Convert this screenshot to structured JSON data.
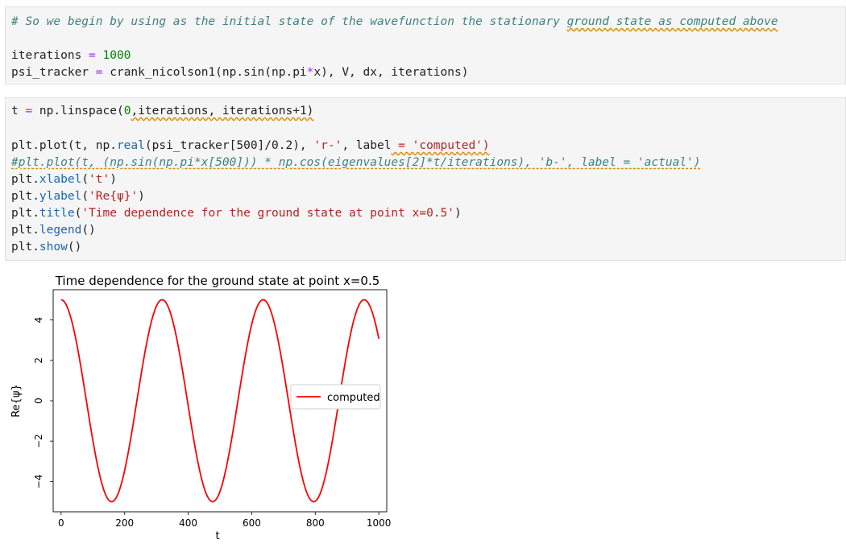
{
  "cell1": {
    "comment": "# So we begin by using as the initial state of the wavefunction the stationary ",
    "comment_flagged": "ground state as computed above",
    "line2_var": "iterations ",
    "line2_op": "=",
    "line2_num": " 1000",
    "line3_a": "psi_tracker ",
    "line3_op": "=",
    "line3_b": " crank_nicolson1(np.sin(np.pi",
    "line3_op2": "*",
    "line3_c": "x), V, dx, iterations)"
  },
  "cell2": {
    "l1_a": "t ",
    "l1_op": "=",
    "l1_b": " np.linspace(",
    "l1_num": "0",
    "l1_flag": ",iterations, iterations+1)",
    "l2_a": "plt.plot(t, np.",
    "l2_fn": "real",
    "l2_b": "(psi_tracker[500]/0.2), ",
    "l2_str": "'r-'",
    "l2_c": ", label",
    "l2_flag": " = 'computed')",
    "l3_comment": "#plt.plot(t, (np.sin(np.pi*x[500])) * np.cos(eigenvalues[2]*t/iterations), 'b-', label = 'actual')",
    "l4_a": "plt.",
    "l4_fn": "xlabel",
    "l4_b": "(",
    "l4_str": "'t'",
    "l4_c": ")",
    "l5_a": "plt.",
    "l5_fn": "ylabel",
    "l5_b": "(",
    "l5_str": "'Re{ψ}'",
    "l5_c": ")",
    "l6_a": "plt.",
    "l6_fn": "title",
    "l6_b": "(",
    "l6_str": "'Time dependence for the ground state at point x=0.5'",
    "l6_c": ")",
    "l7_a": "plt.",
    "l7_fn": "legend",
    "l7_b": "()",
    "l8_a": "plt.",
    "l8_fn": "show",
    "l8_b": "()"
  },
  "chart_data": {
    "type": "line",
    "title": "Time dependence for the ground state at point x=0.5",
    "xlabel": "t",
    "ylabel": "Re{ψ}",
    "xlim": [
      -25,
      1025
    ],
    "ylim": [
      -5.5,
      5.5
    ],
    "xticks": [
      0,
      200,
      400,
      600,
      800,
      1000
    ],
    "yticks": [
      -4,
      -2,
      0,
      2,
      4
    ],
    "grid": false,
    "legend_position": "center-right",
    "series": [
      {
        "name": "computed",
        "color": "#ff0000",
        "amplitude": 5.0,
        "period": 318,
        "x": [
          0,
          159,
          318,
          477,
          636,
          795,
          954,
          1000
        ],
        "y": [
          5.0,
          -5.0,
          5.0,
          -5.0,
          5.0,
          -5.0,
          5.0,
          3.2
        ]
      }
    ]
  }
}
